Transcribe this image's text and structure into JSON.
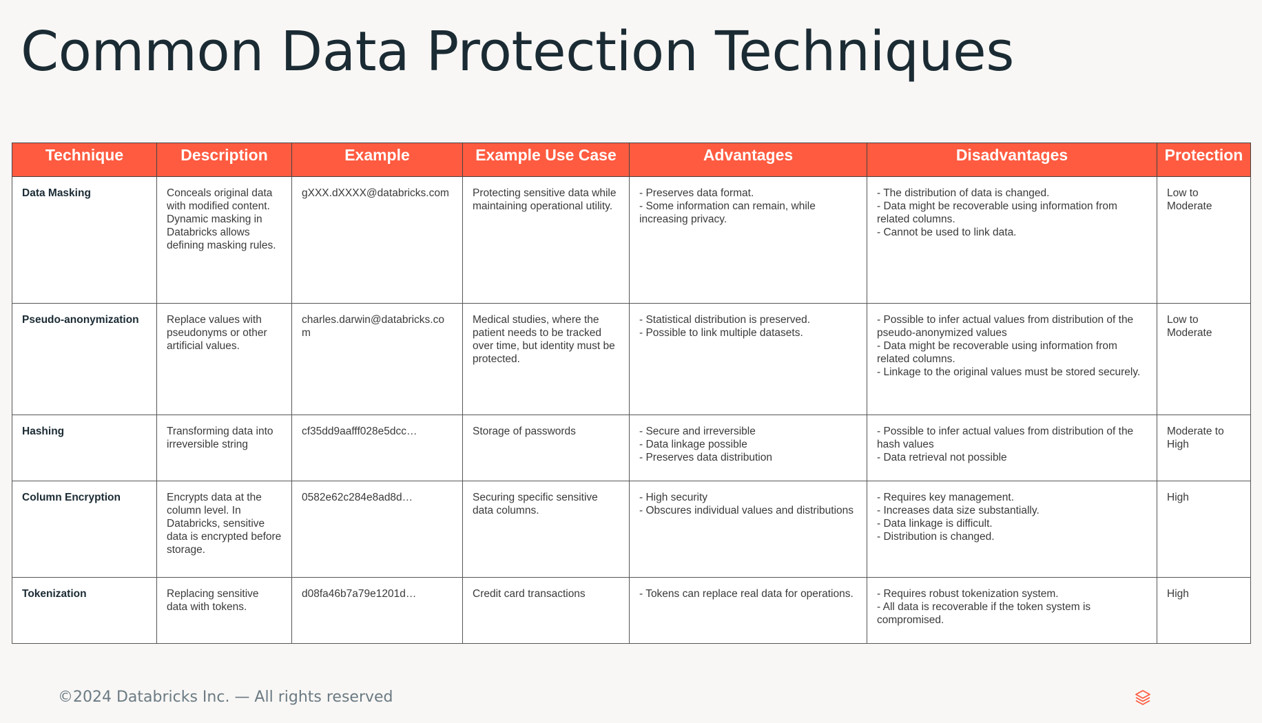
{
  "title": "Common Data Protection Techniques",
  "columns": [
    "Technique",
    "Description",
    "Example",
    "Example Use Case",
    "Advantages",
    "Disadvantages",
    "Protection"
  ],
  "rows": [
    {
      "technique": "Data Masking",
      "description": "Conceals original data with modified content. Dynamic masking in Databricks allows defining masking rules.",
      "example": "gXXX.dXXXX@databricks.com",
      "use_case": "Protecting sensitive data while maintaining operational utility.",
      "advantages": [
        "- Preserves data format.",
        "- Some information can remain, while increasing privacy."
      ],
      "disadvantages": [
        "- The distribution of data is changed.",
        "- Data might be recoverable using information from related columns.",
        "- Cannot be used to link data."
      ],
      "protection": "Low to Moderate"
    },
    {
      "technique": "Pseudo-anonymization",
      "description": "Replace values with pseudonyms or other artificial values.",
      "example": "charles.darwin@databricks.com",
      "use_case": "Medical studies, where the patient needs to be tracked over time, but identity must be protected.",
      "advantages": [
        "- Statistical distribution is preserved.",
        "- Possible to link multiple datasets."
      ],
      "disadvantages": [
        "- Possible to infer actual values from distribution of the pseudo-anonymized values",
        "- Data might be recoverable using information from related columns.",
        "- Linkage to the original values must be stored securely."
      ],
      "protection": "Low to Moderate"
    },
    {
      "technique": "Hashing",
      "description": "Transforming data into irreversible string",
      "example": "cf35dd9aafff028e5dcc…",
      "use_case": "Storage of passwords",
      "advantages": [
        "- Secure and irreversible",
        "- Data linkage possible",
        "- Preserves data distribution"
      ],
      "disadvantages": [
        "- Possible to infer actual values from distribution of the hash values",
        "- Data retrieval not possible"
      ],
      "protection": "Moderate to High"
    },
    {
      "technique": "Column Encryption",
      "description": "Encrypts data at the column level. In Databricks, sensitive data is encrypted before storage.",
      "example": "0582e62c284e8ad8d…",
      "use_case": "Securing specific sensitive data columns.",
      "advantages": [
        "- High security",
        "- Obscures individual values and distributions"
      ],
      "disadvantages": [
        "- Requires key management.",
        "- Increases data size substantially.",
        "- Data linkage is difficult.",
        "- Distribution is changed."
      ],
      "protection": "High"
    },
    {
      "technique": "Tokenization",
      "description": "Replacing sensitive data with tokens.",
      "example": "d08fa46b7a79e1201d…",
      "use_case": "Credit card transactions",
      "advantages": [
        "- Tokens can replace real data for operations."
      ],
      "disadvantages": [
        "- Requires robust tokenization system.",
        "- All data is recoverable if the token system is compromised."
      ],
      "protection": "High"
    }
  ],
  "footer": "©2024 Databricks Inc. — All rights reserved",
  "logo_icon": "databricks-logo-icon",
  "colors": {
    "header_bg": "#ff5b40",
    "title": "#1b2b34",
    "background": "#f8f7f5",
    "footer_text": "#6b7a83"
  }
}
